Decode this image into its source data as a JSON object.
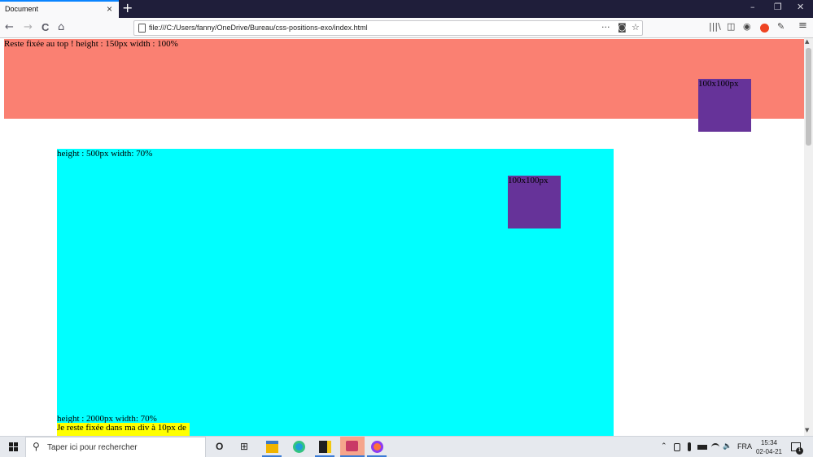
{
  "browser": {
    "tab_title": "Document",
    "tab_close": "×",
    "new_tab": "+",
    "win_minimize": "–",
    "win_restore": "❐",
    "win_close": "✕",
    "back": "←",
    "forward": "→",
    "reload": "C",
    "home": "⌂",
    "url": "file:///C:/Users/fanny/OneDrive/Bureau/css-positions-exo/index.html",
    "url_more": "···",
    "pocket": "◙",
    "bookmark_star": "☆",
    "library": "|||\\",
    "sidebar": "◫",
    "account": "◉",
    "eyedropper": "✎",
    "menu": "≡",
    "scroll_up": "▲",
    "scroll_down": "▼"
  },
  "page": {
    "top_bar_text": "Reste fixée au top ! height : 150px width : 100%",
    "top_square_text": "100x100px",
    "cyan_text": "height : 500px width: 70%",
    "cyan_square_text": "100x100px",
    "cyan_footer_text": "height : 2000px width: 70%",
    "yellow_text": "Je reste fixée dans ma div à 10px de",
    "colors": {
      "top_bar": "#fa8072",
      "square": "#663399",
      "cyan": "#00ffff",
      "yellow": "#ffff00"
    }
  },
  "taskbar": {
    "search_placeholder": "Taper ici pour rechercher",
    "search_icon": "⚲",
    "cortana": "O",
    "task_view": "⊞",
    "chevron": "⌃",
    "language": "FRA",
    "volume": "🔈",
    "time": "15:34",
    "date": "02-04-21",
    "notif_count": "1"
  }
}
